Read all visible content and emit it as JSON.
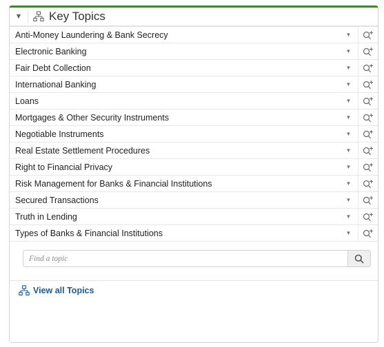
{
  "panel": {
    "title": "Key Topics",
    "collapse_icon": "caret-down-icon",
    "title_icon": "sitemap-icon",
    "accent_color": "#3a8a2c"
  },
  "topics": [
    "Anti-Money Laundering & Bank Secrecy",
    "Electronic Banking",
    "Fair Debt Collection",
    "International Banking",
    "Loans",
    "Mortgages & Other Security Instruments",
    "Negotiable Instruments",
    "Real Estate Settlement Procedures",
    "Right to Financial Privacy",
    "Risk Management for Banks & Financial Institutions",
    "Secured Transactions",
    "Truth in Lending",
    "Types of Banks & Financial Institutions"
  ],
  "row_icons": {
    "dropdown": "caret-down-icon",
    "search": "search-plus-icon"
  },
  "search": {
    "placeholder": "Find a topic",
    "button_icon": "search-icon"
  },
  "footer": {
    "link_label": "View all Topics",
    "link_icon": "sitemap-icon",
    "link_color": "#1a5a96"
  }
}
